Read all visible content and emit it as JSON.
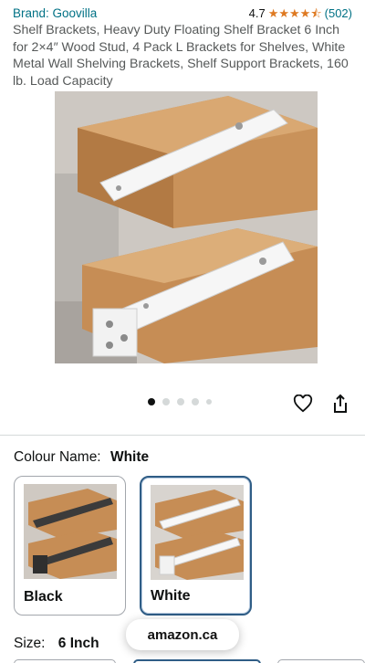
{
  "brand": {
    "label": "Brand: Goovilla"
  },
  "rating": {
    "value": "4.7",
    "stars_filled": 4.5,
    "count": "(502)"
  },
  "title": "Shelf Brackets, Heavy Duty Floating Shelf Bracket 6 Inch for 2×4″ Wood Stud, 4 Pack L Brackets for Shelves, White Metal Wall Shelving Brackets, Shelf Support Brackets, 160 lb. Load Capacity",
  "gallery": {
    "current_index": 1,
    "dot_count": 5
  },
  "icons": {
    "wishlist": "heart-outline-icon",
    "share": "share-icon"
  },
  "colour": {
    "label": "Colour Name:",
    "selected": "White",
    "options": [
      {
        "label": "Black",
        "selected": false
      },
      {
        "label": "White",
        "selected": true
      }
    ]
  },
  "size": {
    "label": "Size:",
    "selected": "6 Inch"
  },
  "domain_pill": "amazon.ca",
  "colors": {
    "link": "#007185",
    "star": "#de7921",
    "selected_border": "#2f5d86"
  }
}
